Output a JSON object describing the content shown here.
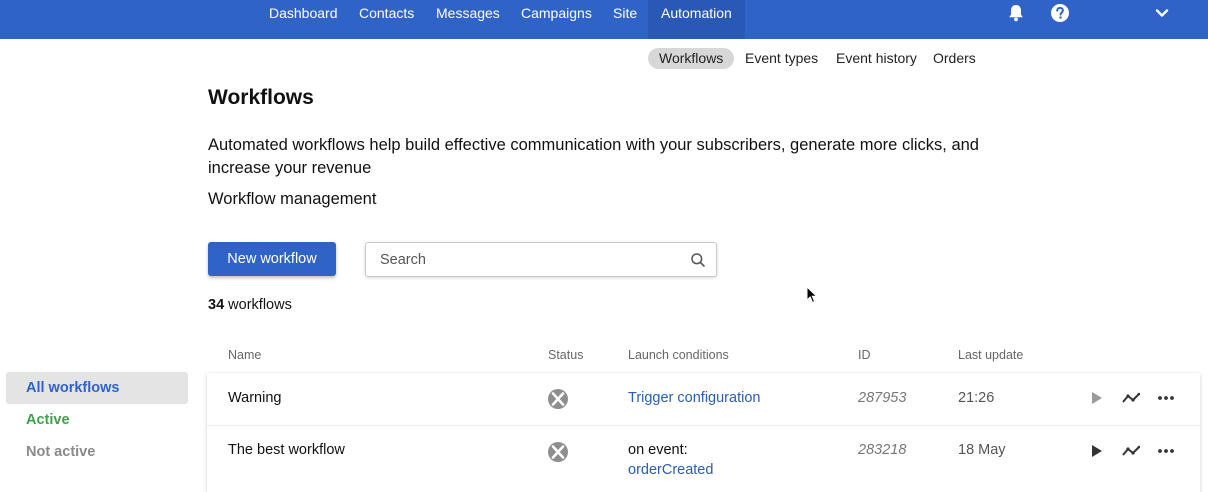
{
  "topnav": {
    "items": [
      "Dashboard",
      "Contacts",
      "Messages",
      "Campaigns",
      "Site",
      "Automation"
    ],
    "active": "Automation"
  },
  "subnav": {
    "items": [
      "Workflows",
      "Event types",
      "Event history",
      "Orders"
    ],
    "active": "Workflows"
  },
  "page": {
    "title": "Workflows",
    "description": "Automated workflows help build effective communication with your subscribers, generate more clicks, and increase your revenue",
    "subtitle": "Workflow management"
  },
  "toolbar": {
    "new_button_label": "New workflow",
    "search_placeholder": "Search"
  },
  "count": {
    "number": "34",
    "label": "workflows"
  },
  "filters": [
    "All workflows",
    "Active",
    "Not active"
  ],
  "table": {
    "headers": [
      "Name",
      "Status",
      "Launch conditions",
      "ID",
      "Last update"
    ],
    "rows": [
      {
        "name": "Warning",
        "launch_prefix": "",
        "launch_link": "Trigger configuration",
        "id": "287953",
        "updated": "21:26"
      },
      {
        "name": "The best workflow",
        "launch_prefix": "on event:",
        "launch_link": "orderCreated",
        "id": "283218",
        "updated": "18 May"
      }
    ]
  },
  "icons": {
    "notifications": "bell-icon",
    "help": "help-icon",
    "menu": "chevron-down-icon",
    "search": "search-icon",
    "status": "status-inactive-icon",
    "row_actions": [
      "play-icon",
      "stats-icon",
      "more-icon"
    ]
  },
  "colors": {
    "brand": "#2f63c8",
    "link": "#2a5db0",
    "active_filter": "#3fa14a",
    "inactive_filter": "#8a8a8a"
  }
}
